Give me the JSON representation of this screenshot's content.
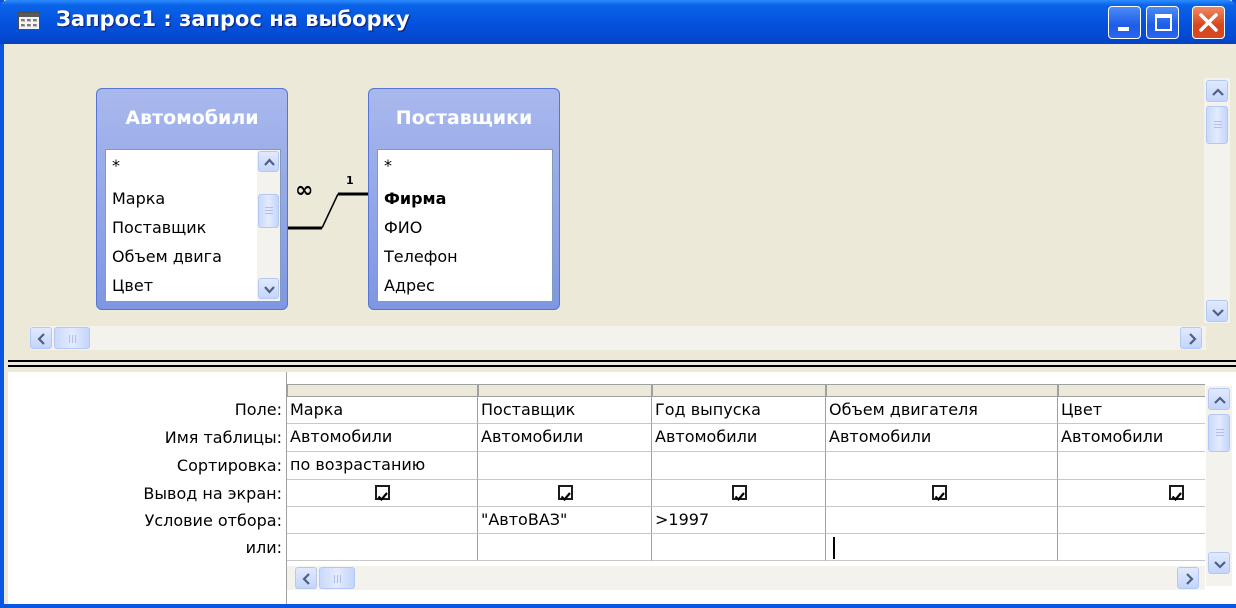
{
  "window": {
    "title": "Запрос1 : запрос на выборку",
    "minimize_label": "minimize-icon",
    "maximize_label": "maximize-icon",
    "close_label": "close-icon"
  },
  "tables": [
    {
      "name": "Автомобили",
      "fields": [
        "*",
        "Марка",
        "Поставщик",
        "Объем двига",
        "Цвет"
      ]
    },
    {
      "name": "Поставщики",
      "fields": [
        "*",
        "Фирма",
        "ФИО",
        "Телефон",
        "Адрес"
      ]
    }
  ],
  "relationship": {
    "many_side": "∞",
    "one_side": "1"
  },
  "grid": {
    "row_labels": [
      "Поле:",
      "Имя таблицы:",
      "Сортировка:",
      "Вывод на экран:",
      "Условие отбора:",
      "или:"
    ],
    "columns": [
      {
        "field": "Марка",
        "table": "Автомобили",
        "sort": "по возрастанию",
        "show": true,
        "criteria": "",
        "or": ""
      },
      {
        "field": "Поставщик",
        "table": "Автомобили",
        "sort": "",
        "show": true,
        "criteria": "\"АвтоВАЗ\"",
        "or": ""
      },
      {
        "field": "Год выпуска",
        "table": "Автомобили",
        "sort": "",
        "show": true,
        "criteria": ">1997",
        "or": ""
      },
      {
        "field": "Объем двигателя",
        "table": "Автомобили",
        "sort": "",
        "show": true,
        "criteria": "",
        "or": ""
      },
      {
        "field": "Цвет",
        "table": "Автомобили",
        "sort": "",
        "show": true,
        "criteria": "",
        "or": ""
      }
    ]
  },
  "colors": {
    "titlebar": "#0553df",
    "window_face": "#ece9d8",
    "table_header": "#8fa2e6",
    "close_button": "#d6451e"
  }
}
